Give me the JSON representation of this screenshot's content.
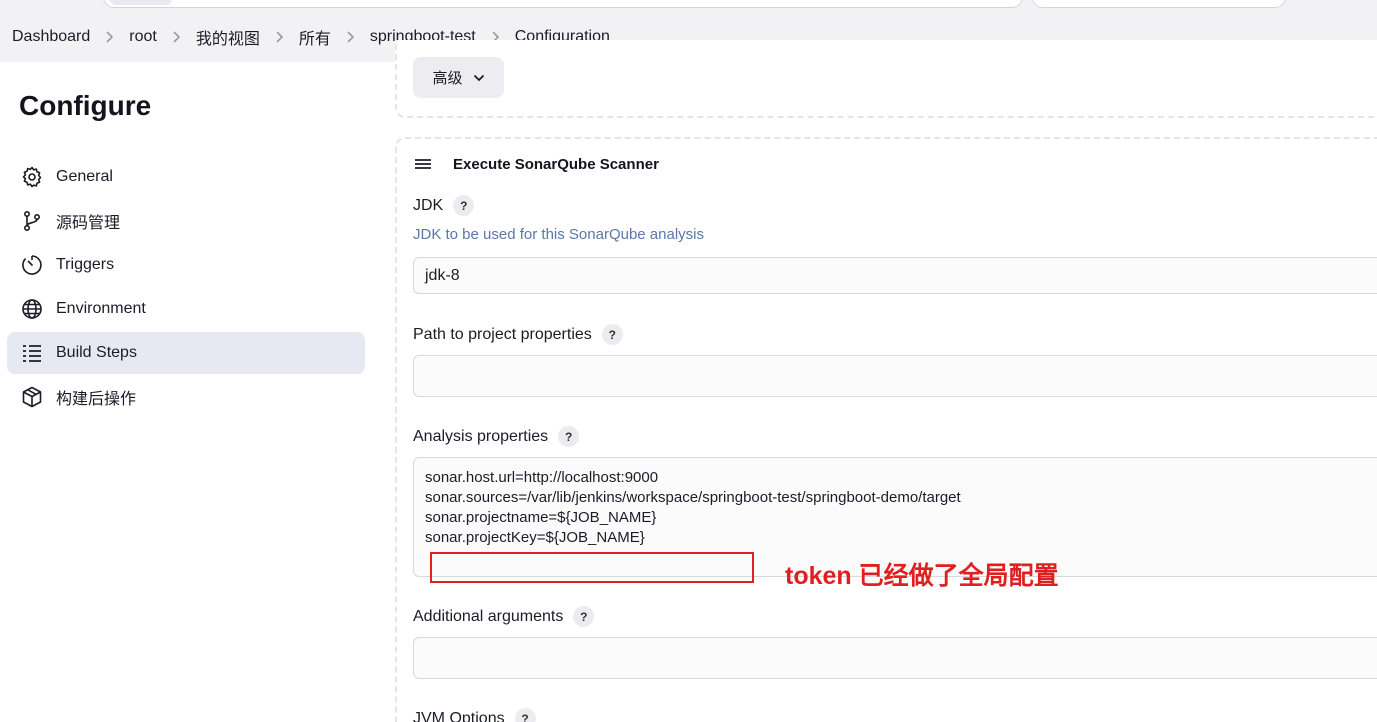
{
  "breadcrumb": [
    "Dashboard",
    "root",
    "我的视图",
    "所有",
    "springboot-test",
    "Configuration"
  ],
  "sidebar": {
    "title": "Configure",
    "items": [
      {
        "label": "General",
        "icon": "gear-icon"
      },
      {
        "label": "源码管理",
        "icon": "source-branch-icon"
      },
      {
        "label": "Triggers",
        "icon": "timer-icon"
      },
      {
        "label": "Environment",
        "icon": "globe-icon"
      },
      {
        "label": "Build Steps",
        "icon": "list-steps-icon",
        "active": true
      },
      {
        "label": "构建后操作",
        "icon": "package-icon"
      }
    ]
  },
  "advanced_button": {
    "label": "高级"
  },
  "step": {
    "title": "Execute SonarQube Scanner",
    "jdk": {
      "label": "JDK",
      "description": "JDK to be used for this SonarQube analysis",
      "value": "jdk-8"
    },
    "path_to_properties": {
      "label": "Path to project properties",
      "value": ""
    },
    "analysis_properties": {
      "label": "Analysis properties",
      "lines": [
        "sonar.host.url=http://localhost:9000",
        "sonar.sources=/var/lib/jenkins/workspace/springboot-test/springboot-demo/target",
        "sonar.projectname=${JOB_NAME}",
        "sonar.projectKey=${JOB_NAME}"
      ]
    },
    "additional_arguments": {
      "label": "Additional arguments",
      "value": ""
    },
    "jvm_options": {
      "label": "JVM Options"
    }
  },
  "help_label": "?",
  "annotation": {
    "text": "token 已经做了全局配置",
    "color": "#e02020"
  }
}
